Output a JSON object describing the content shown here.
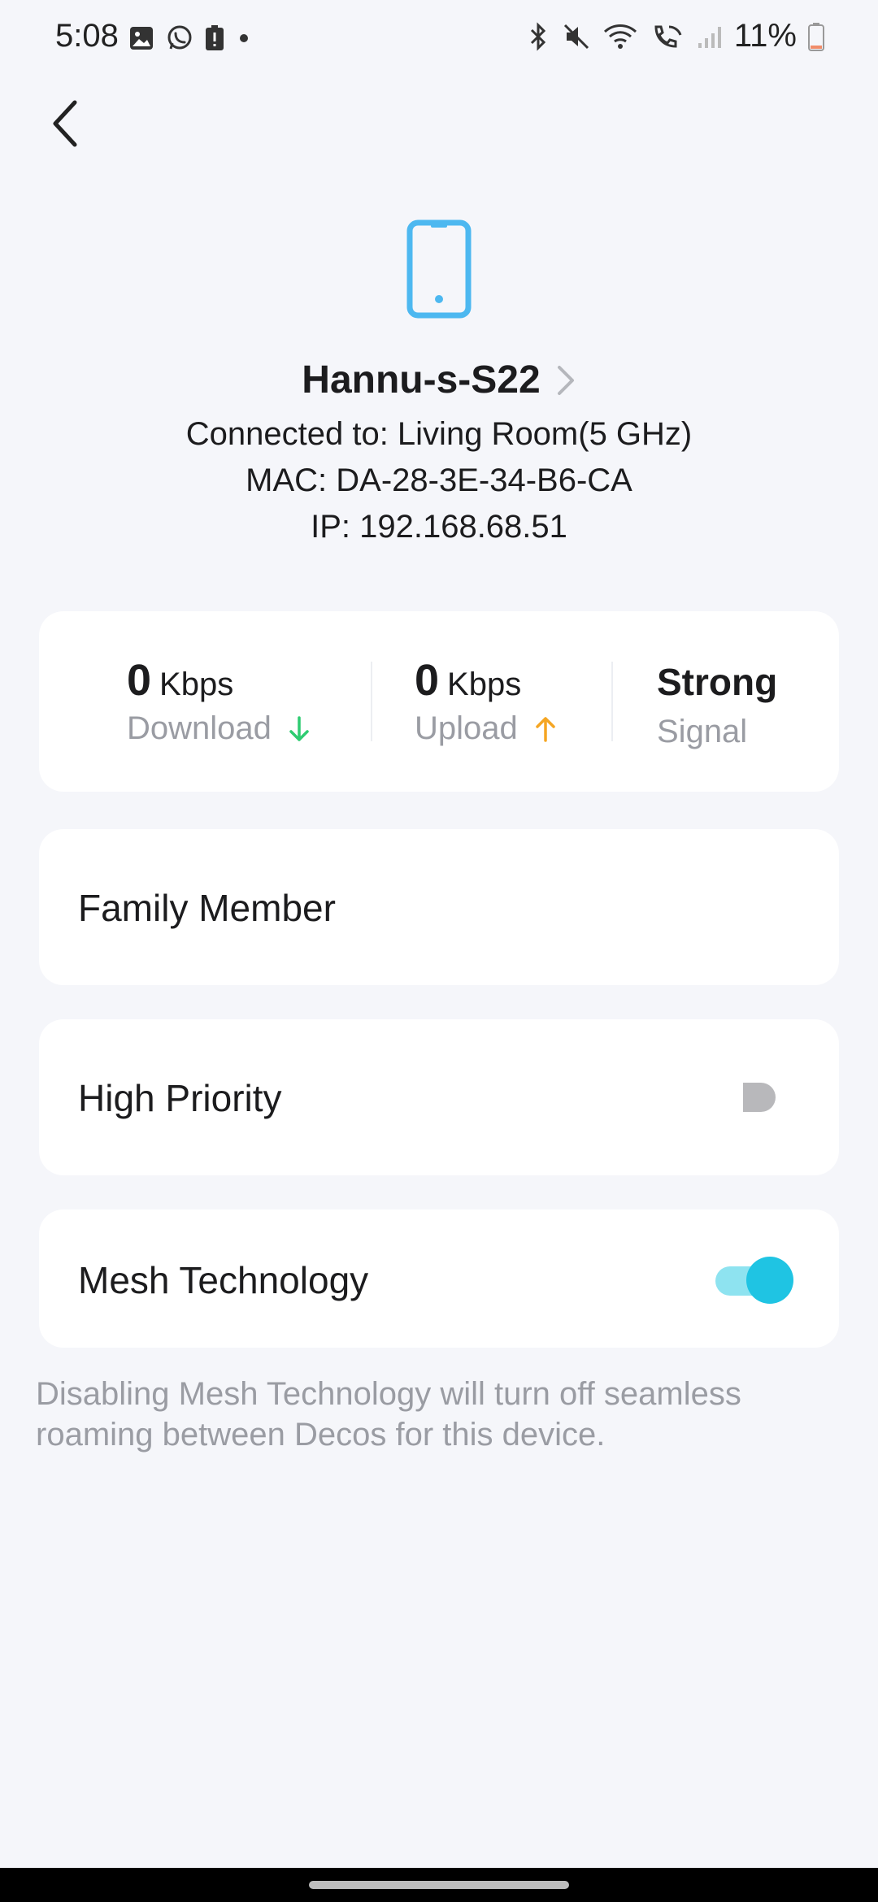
{
  "status_bar": {
    "time": "5:08",
    "battery": "11%",
    "left_icons": [
      "gallery-icon",
      "whatsapp-icon",
      "alert-icon",
      "dot-icon"
    ],
    "right_icons": [
      "bluetooth-icon",
      "mute-icon",
      "wifi-icon",
      "wifi-call-icon",
      "signal-icon",
      "battery-icon"
    ]
  },
  "device": {
    "name": "Hannu-s-S22",
    "connected_to": "Connected to: Living Room(5 GHz)",
    "mac": "MAC: DA-28-3E-34-B6-CA",
    "ip": "IP: 192.168.68.51",
    "icon": "phone-icon"
  },
  "stats": {
    "download": {
      "value": "0",
      "unit": "Kbps",
      "label": "Download"
    },
    "upload": {
      "value": "0",
      "unit": "Kbps",
      "label": "Upload"
    },
    "signal": {
      "value": "Strong",
      "label": "Signal"
    }
  },
  "family_member": {
    "label": "Family Member"
  },
  "high_priority": {
    "label": "High Priority",
    "enabled": false
  },
  "mesh_technology": {
    "label": "Mesh Technology",
    "enabled": true
  },
  "help_text": "Disabling Mesh Technology will turn off seamless roaming between Decos for this device.",
  "colors": {
    "accent": "#1fc4e3",
    "accent_light": "#8ee3f0",
    "download_arrow": "#2ecc71",
    "upload_arrow": "#f5a623",
    "muted_text": "#9a9ca3",
    "device_icon": "#4db8f0"
  }
}
